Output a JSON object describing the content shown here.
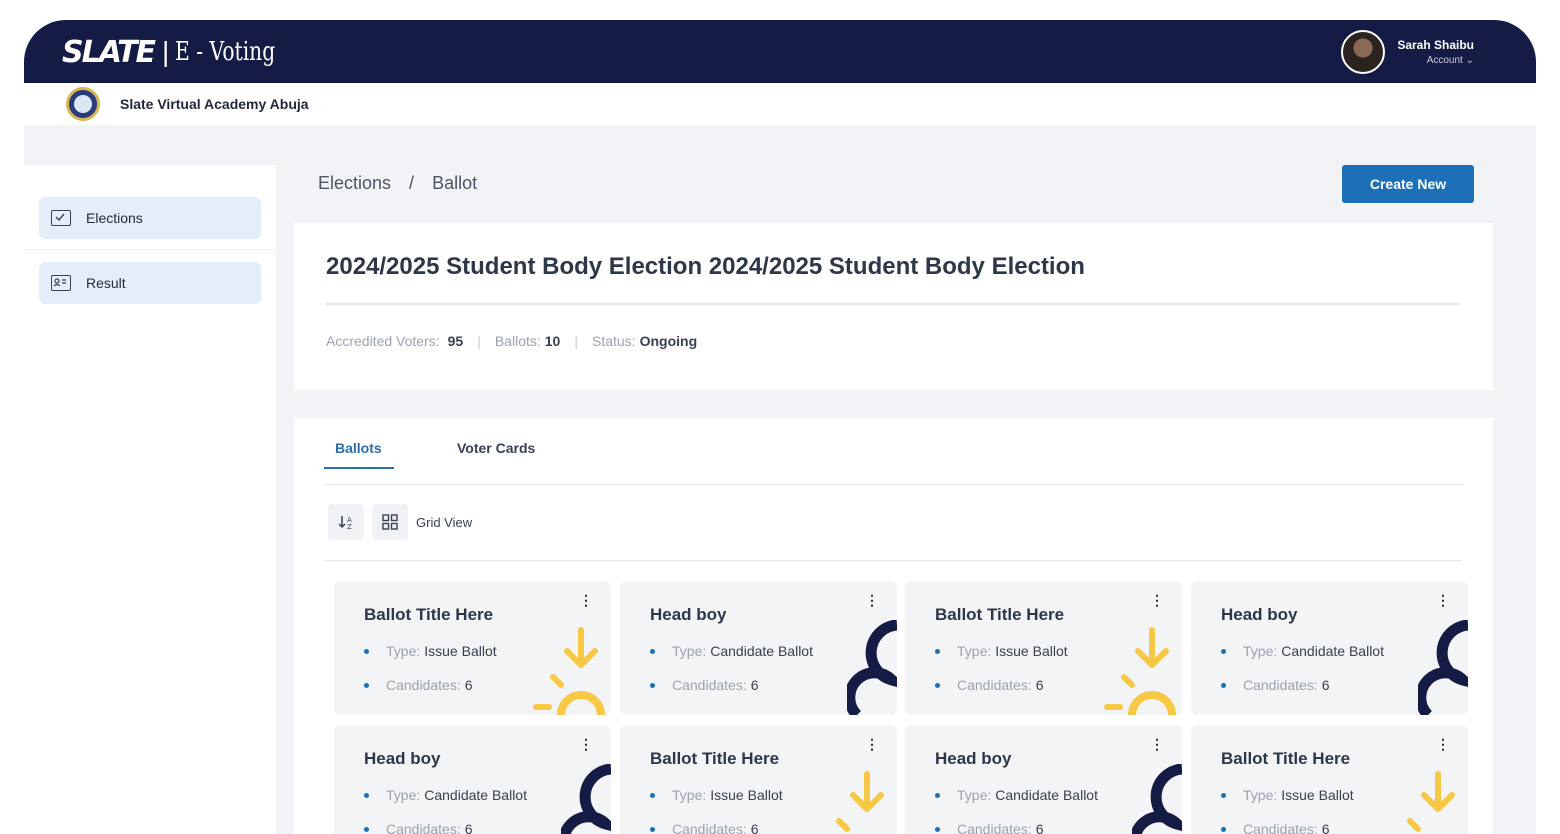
{
  "app": {
    "logo_brand": "SLATE",
    "logo_product": "E - Voting",
    "user_name": "Sarah Shaibu",
    "user_sub": "Account ⌄"
  },
  "school": {
    "name": "Slate Virtual Academy Abuja"
  },
  "sidebar": {
    "items": [
      {
        "label": "Elections",
        "icon": "ballot-box-icon"
      },
      {
        "label": "Result",
        "icon": "id-card-icon"
      }
    ]
  },
  "breadcrumb": {
    "root": "Elections",
    "sep": "/",
    "current": "Ballot"
  },
  "actions": {
    "create_label": "Create New"
  },
  "election": {
    "title": "2024/2025 Student Body Election 2024/2025 Student Body Election",
    "voters_label": "Accredited Voters:",
    "voters_value": "95",
    "ballots_label": "Ballots:",
    "ballots_value": "10",
    "status_label": "Status:",
    "status_value": "Ongoing"
  },
  "tabs": [
    {
      "label": "Ballots",
      "active": true
    },
    {
      "label": "Voter Cards",
      "active": false
    }
  ],
  "toolbar": {
    "sort_icon": "sort-icon",
    "grid_icon": "grid-icon",
    "view_label": "Grid View"
  },
  "cards": [
    {
      "title": "Ballot Title Here",
      "type_label": "Type:",
      "type": "Issue Ballot",
      "cand_label": "Candidates:",
      "candidates": "6",
      "deco": "sun"
    },
    {
      "title": "Head boy",
      "type_label": "Type:",
      "type": "Candidate Ballot",
      "cand_label": "Candidates:",
      "candidates": "6",
      "deco": "arc"
    },
    {
      "title": "Ballot Title Here",
      "type_label": "Type:",
      "type": "Issue Ballot",
      "cand_label": "Candidates:",
      "candidates": "6",
      "deco": "sun"
    },
    {
      "title": "Head boy",
      "type_label": "Type:",
      "type": "Candidate Ballot",
      "cand_label": "Candidates:",
      "candidates": "6",
      "deco": "arc"
    },
    {
      "title": "Head boy",
      "type_label": "Type:",
      "type": "Candidate Ballot",
      "cand_label": "Candidates:",
      "candidates": "6",
      "deco": "arc"
    },
    {
      "title": "Ballot Title Here",
      "type_label": "Type:",
      "type": "Issue Ballot",
      "cand_label": "Candidates:",
      "candidates": "6",
      "deco": "sun"
    },
    {
      "title": "Head boy",
      "type_label": "Type:",
      "type": "Candidate Ballot",
      "cand_label": "Candidates:",
      "candidates": "6",
      "deco": "arc"
    },
    {
      "title": "Ballot Title Here",
      "type_label": "Type:",
      "type": "Issue Ballot",
      "cand_label": "Candidates:",
      "candidates": "6",
      "deco": "sun"
    }
  ],
  "colors": {
    "navy": "#141b45",
    "accent": "#1d6fb8",
    "yellow": "#f7c843"
  }
}
